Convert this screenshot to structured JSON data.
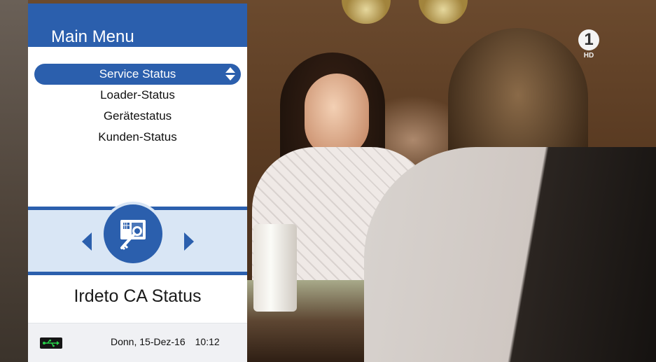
{
  "channel": {
    "logo_text": "1",
    "badge": "HD"
  },
  "panel": {
    "title": "Main Menu",
    "menu_items": [
      {
        "label": "Service Status",
        "selected": true
      },
      {
        "label": "Loader-Status",
        "selected": false
      },
      {
        "label": "Gerätestatus",
        "selected": false
      },
      {
        "label": "Kunden-Status",
        "selected": false
      }
    ],
    "section_label": "Irdeto CA Status",
    "section_icon": "smartcard-key-icon"
  },
  "status_bar": {
    "usb_icon": "usb-icon",
    "date": "Donn, 15-Dez-16",
    "time": "10:12"
  },
  "colors": {
    "accent": "#2b5fad",
    "carousel_bg": "#d9e6f5",
    "panel_bg": "#ffffff"
  }
}
